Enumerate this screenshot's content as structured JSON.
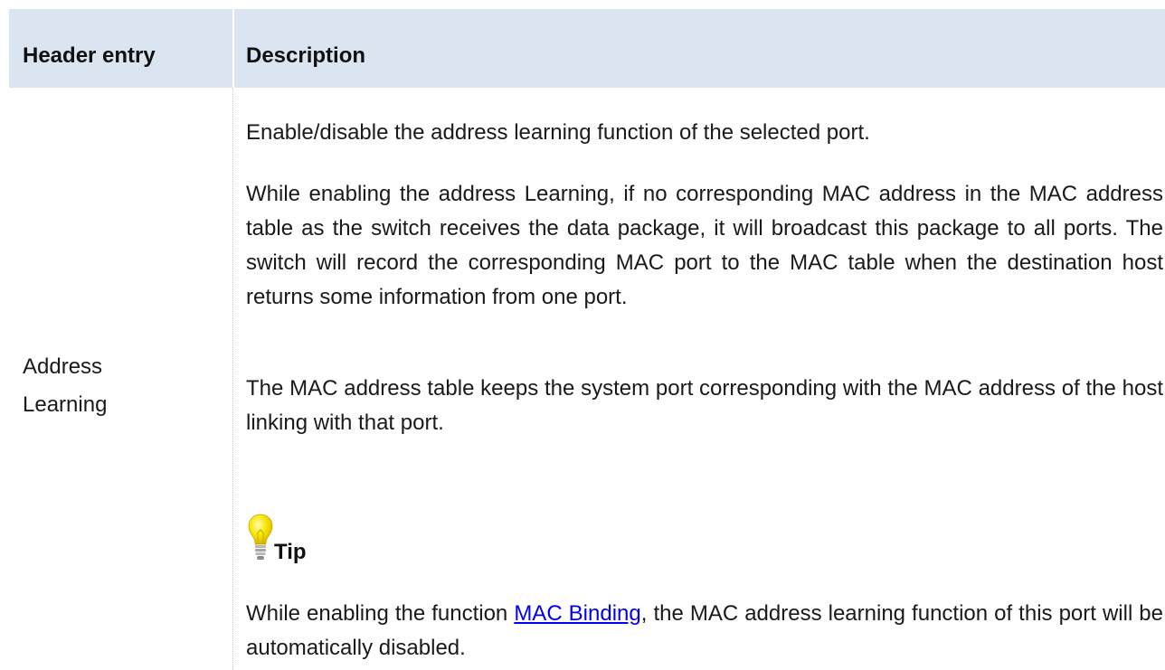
{
  "table": {
    "headers": {
      "col1": "Header entry",
      "col2": "Description"
    },
    "rows": [
      {
        "label_line1": "Address",
        "label_line2": "Learning",
        "paragraphs": [
          "Enable/disable the address learning function of the selected port.",
          "While enabling the address Learning, if no corresponding MAC address in the MAC address table as the switch receives the data package, it will broadcast this package to all ports. The switch will record the corresponding MAC port to the MAC table when the destination host returns some information from one port.",
          "The MAC address table keeps the system port corresponding with the MAC address of the host linking with that port."
        ],
        "tip": {
          "icon": "lightbulb-icon",
          "label": "Tip",
          "text_before": "While enabling the function ",
          "link_text": "MAC Binding",
          "text_after": ", the MAC address learning function of this port will be automatically disabled."
        }
      }
    ]
  },
  "colors": {
    "header_background": "#dbe5f1",
    "link": "#0000ee",
    "bulb_yellow": "#f7e600"
  }
}
